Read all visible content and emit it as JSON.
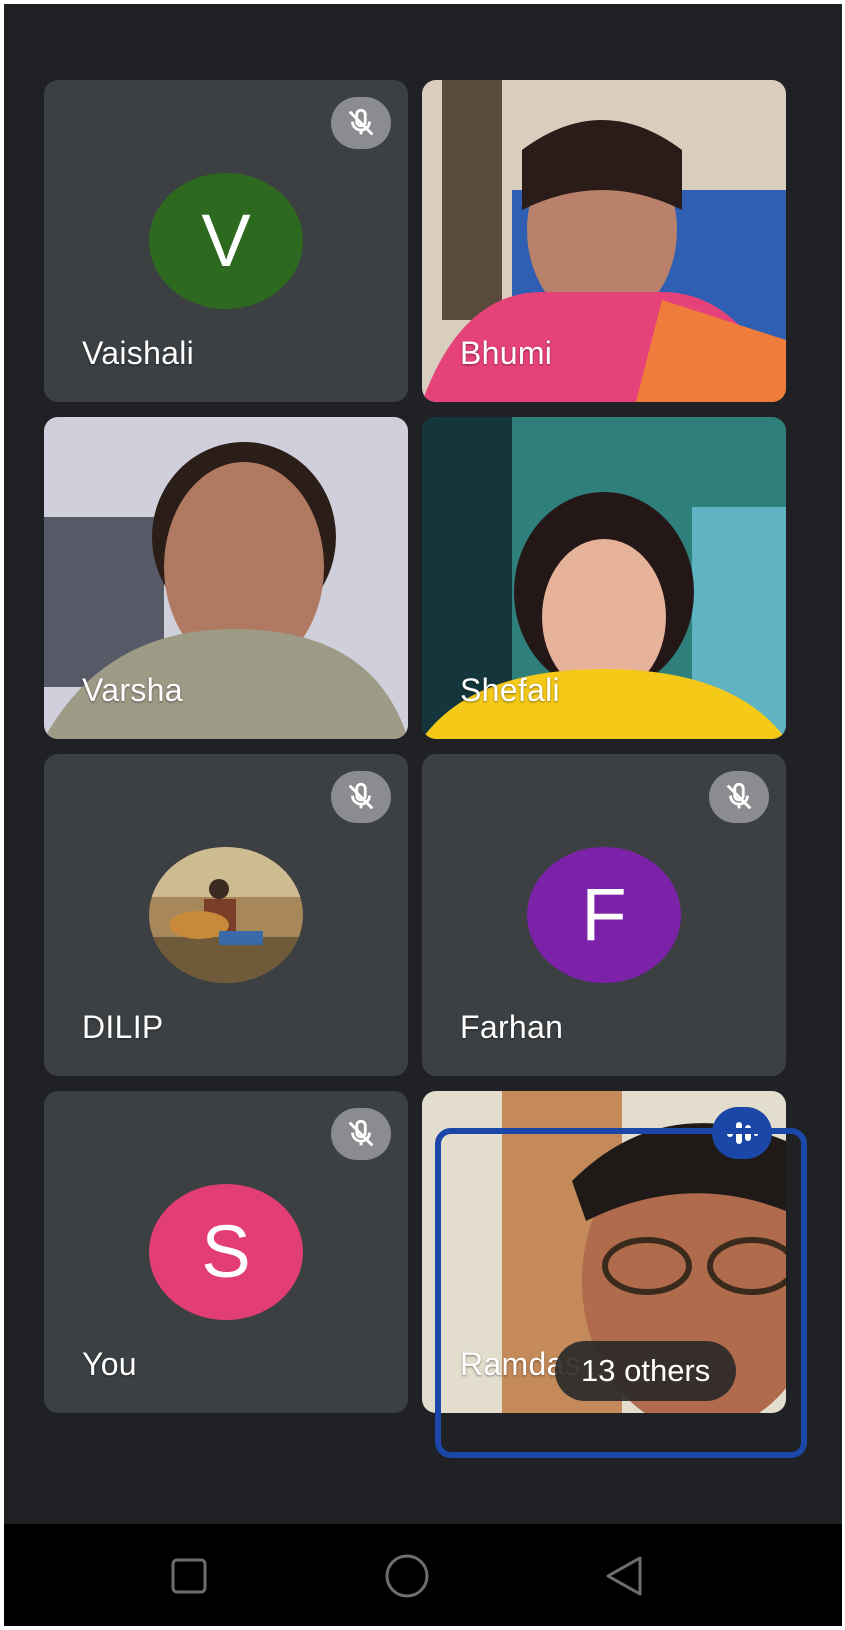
{
  "participants": [
    {
      "name": "Vaishali",
      "initial": "V",
      "avatar_color": "#2d6a1f",
      "muted": true
    },
    {
      "name": "Bhumi",
      "video": true
    },
    {
      "name": "Varsha",
      "video": true
    },
    {
      "name": "Shefali",
      "video": true
    },
    {
      "name": "DILIP",
      "photo": true,
      "muted": true
    },
    {
      "name": "Farhan",
      "initial": "F",
      "avatar_color": "#7b22a8",
      "muted": true
    },
    {
      "name": "You",
      "initial": "S",
      "avatar_color": "#e23e74",
      "muted": true
    },
    {
      "name": "Ramdas",
      "video": true,
      "speaking": true
    }
  ],
  "others_chip": "13 others",
  "colors": {
    "speaking_accent": "#1a47a8",
    "tile_bg": "#3c4043",
    "screen_bg": "#202124"
  },
  "icons": {
    "muted": "mic-off-icon",
    "speaking": "audio-wave-icon"
  },
  "navbar": {
    "buttons": [
      "recents-square-icon",
      "home-circle-icon",
      "back-triangle-icon"
    ]
  }
}
